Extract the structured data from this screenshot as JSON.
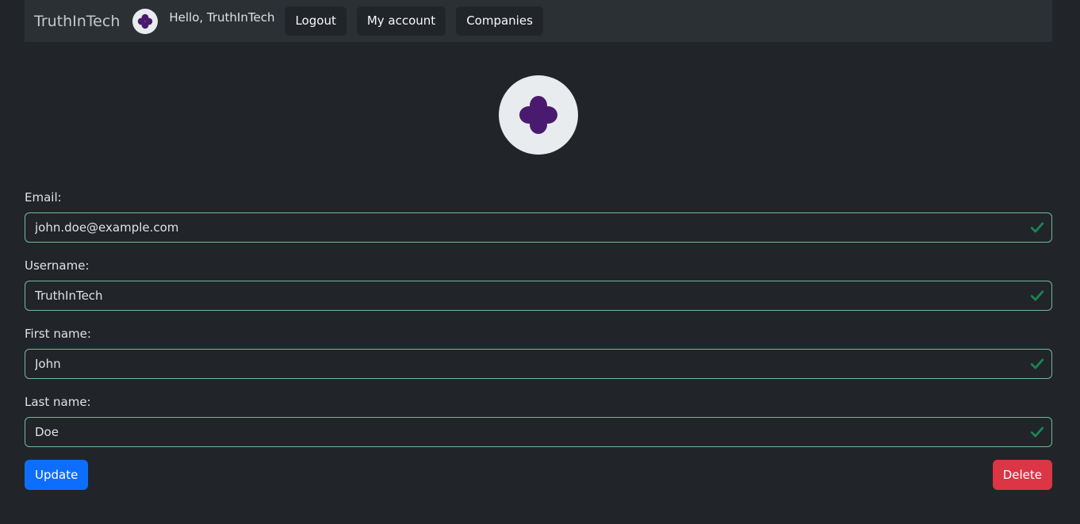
{
  "navbar": {
    "brand": "TruthInTech",
    "greeting": "Hello, TruthInTech",
    "logout_label": "Logout",
    "account_label": "My account",
    "companies_label": "Companies"
  },
  "profile": {
    "avatar_icon": "flower-avatar-icon"
  },
  "form": {
    "email_label": "Email:",
    "email_value": "john.doe@example.com",
    "username_label": "Username:",
    "username_value": "TruthInTech",
    "firstname_label": "First name:",
    "firstname_value": "John",
    "lastname_label": "Last name:",
    "lastname_value": "Doe"
  },
  "actions": {
    "update_label": "Update",
    "delete_label": "Delete"
  },
  "colors": {
    "avatar_fill": "#4a1a6e",
    "valid": "#198754",
    "primary": "#0d6efd",
    "danger": "#dc3545"
  }
}
